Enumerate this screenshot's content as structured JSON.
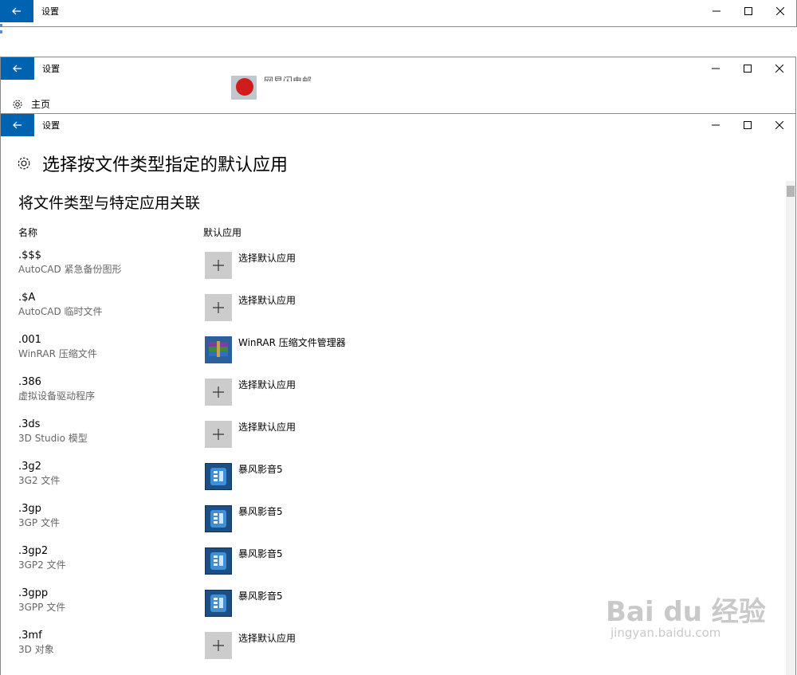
{
  "windows": {
    "top": {
      "title": "设置"
    },
    "middle": {
      "title": "设置",
      "home_label": "主页",
      "partial_text": "网易闪电邮"
    },
    "main": {
      "title": "设置"
    }
  },
  "page": {
    "heading": "选择按文件类型指定的默认应用",
    "section_title": "将文件类型与特定应用关联",
    "col_name": "名称",
    "col_app": "默认应用"
  },
  "rows": [
    {
      "ext": ".$$$",
      "desc": "AutoCAD 紧急备份图形",
      "app": "选择默认应用",
      "icon": "plus-icon"
    },
    {
      "ext": ".$A",
      "desc": "AutoCAD 临时文件",
      "app": "选择默认应用",
      "icon": "plus-icon"
    },
    {
      "ext": ".001",
      "desc": "WinRAR 压缩文件",
      "app": "WinRAR 压缩文件管理器",
      "icon": "winrar-icon"
    },
    {
      "ext": ".386",
      "desc": "虚拟设备驱动程序",
      "app": "选择默认应用",
      "icon": "plus-icon"
    },
    {
      "ext": ".3ds",
      "desc": "3D Studio 模型",
      "app": "选择默认应用",
      "icon": "plus-icon"
    },
    {
      "ext": ".3g2",
      "desc": "3G2 文件",
      "app": "暴风影音5",
      "icon": "baofeng-icon"
    },
    {
      "ext": ".3gp",
      "desc": "3GP 文件",
      "app": "暴风影音5",
      "icon": "baofeng-icon"
    },
    {
      "ext": ".3gp2",
      "desc": "3GP2 文件",
      "app": "暴风影音5",
      "icon": "baofeng-icon"
    },
    {
      "ext": ".3gpp",
      "desc": "3GPP 文件",
      "app": "暴风影音5",
      "icon": "baofeng-icon"
    },
    {
      "ext": ".3mf",
      "desc": "3D 对象",
      "app": "选择默认应用",
      "icon": "plus-icon"
    }
  ],
  "watermark": {
    "main": "Bai du 经验",
    "sub": "jingyan.baidu.com"
  },
  "colors": {
    "accent": "#0063b1",
    "plus_bg": "#cccccc"
  }
}
